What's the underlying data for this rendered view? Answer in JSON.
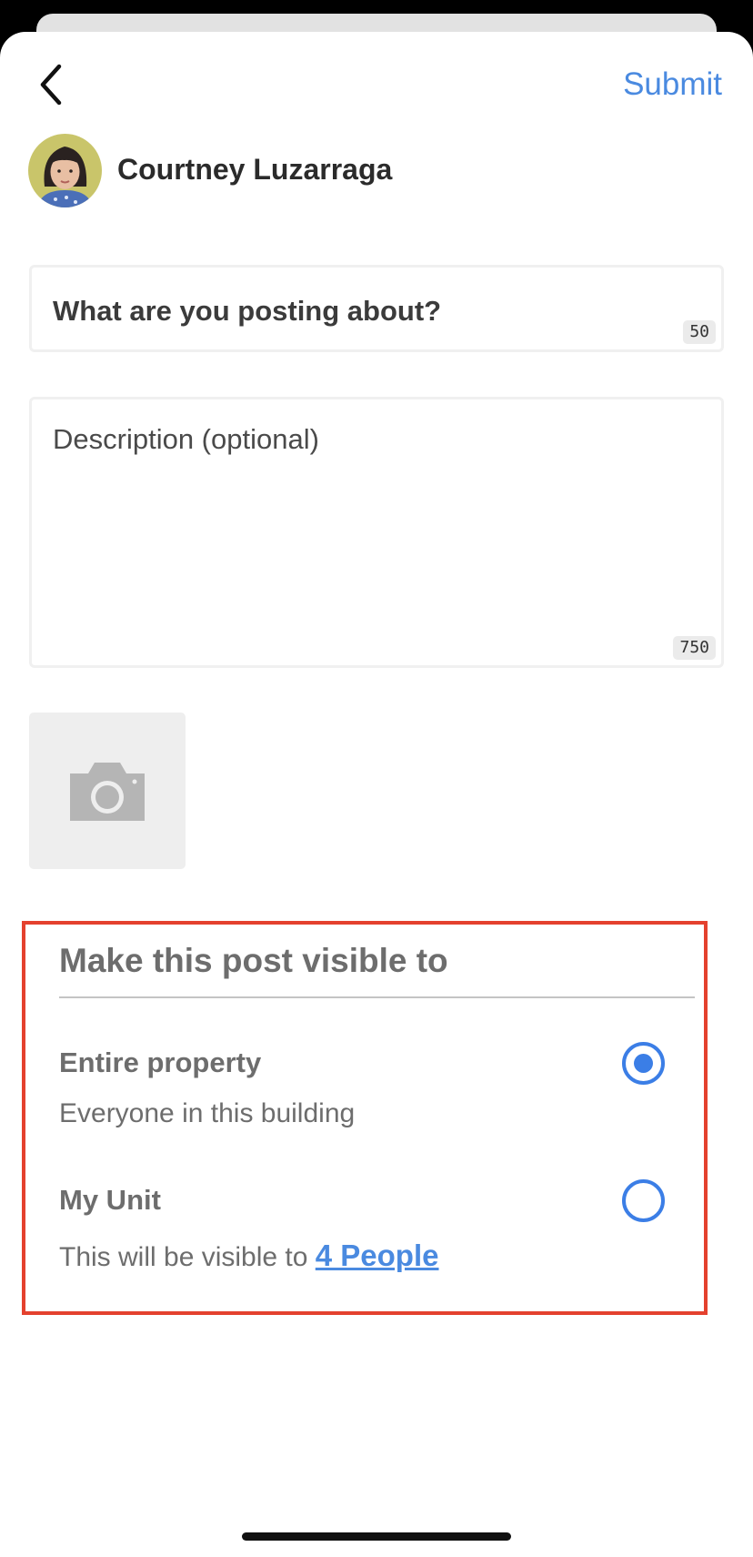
{
  "header": {
    "back_icon": "chevron-left-icon",
    "submit_label": "Submit"
  },
  "user": {
    "name": "Courtney Luzarraga"
  },
  "form": {
    "title_placeholder": "What are you posting about?",
    "title_counter": "50",
    "description_placeholder": "Description (optional)",
    "description_counter": "750",
    "photo_icon": "camera-icon"
  },
  "visibility": {
    "heading": "Make this post visible to",
    "options": [
      {
        "label": "Entire property",
        "description": "Everyone in this building",
        "selected": true
      },
      {
        "label": "My Unit",
        "description_prefix": "This will be visible to ",
        "link_text": "4 People",
        "selected": false
      }
    ]
  },
  "colors": {
    "accent": "#3b7ee6",
    "link": "#4a8ae0",
    "highlight_border": "#e4412e"
  }
}
